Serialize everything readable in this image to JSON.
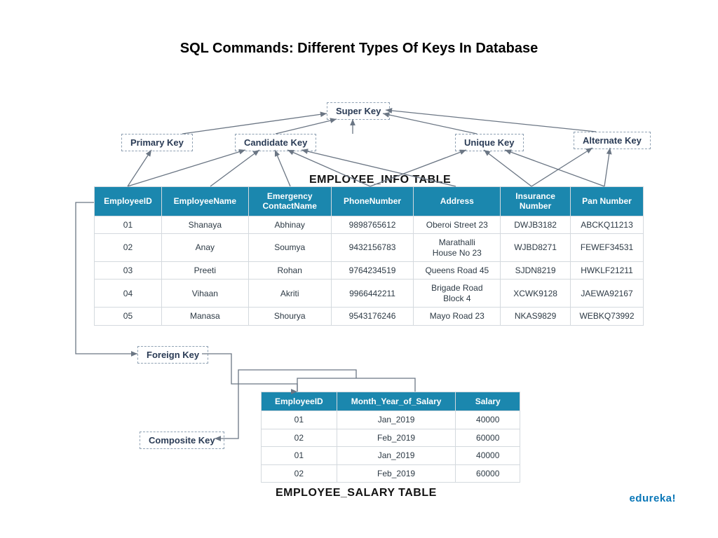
{
  "title": "SQL Commands: Different Types Of Keys In Database",
  "keys": {
    "super": "Super Key",
    "primary": "Primary Key",
    "candidate": "Candidate Key",
    "unique": "Unique Key",
    "alternate": "Alternate Key",
    "foreign": "Foreign Key",
    "composite": "Composite Key"
  },
  "table1": {
    "title": "EMPLOYEE_INFO TABLE",
    "headers": [
      "EmployeeID",
      "EmployeeName",
      "Emergency ContactName",
      "PhoneNumber",
      "Address",
      "Insurance Number",
      "Pan Number"
    ],
    "rows": [
      [
        "01",
        "Shanaya",
        "Abhinay",
        "9898765612",
        "Oberoi Street 23",
        "DWJB3182",
        "ABCKQ11213"
      ],
      [
        "02",
        "Anay",
        "Soumya",
        "9432156783",
        "Marathalli House No 23",
        "WJBD8271",
        "FEWEF34531"
      ],
      [
        "03",
        "Preeti",
        "Rohan",
        "9764234519",
        "Queens Road 45",
        "SJDN8219",
        "HWKLF21211"
      ],
      [
        "04",
        "Vihaan",
        "Akriti",
        "9966442211",
        "Brigade Road Block 4",
        "XCWK9128",
        "JAEWA92167"
      ],
      [
        "05",
        "Manasa",
        "Shourya",
        "9543176246",
        "Mayo Road 23",
        "NKAS9829",
        "WEBKQ73992"
      ]
    ]
  },
  "table2": {
    "title": "EMPLOYEE_SALARY TABLE",
    "headers": [
      "EmployeeID",
      "Month_Year_of_Salary",
      "Salary"
    ],
    "rows": [
      [
        "01",
        "Jan_2019",
        "40000"
      ],
      [
        "02",
        "Feb_2019",
        "60000"
      ],
      [
        "01",
        "Jan_2019",
        "40000"
      ],
      [
        "02",
        "Feb_2019",
        "60000"
      ]
    ]
  },
  "brand": "edureka!"
}
